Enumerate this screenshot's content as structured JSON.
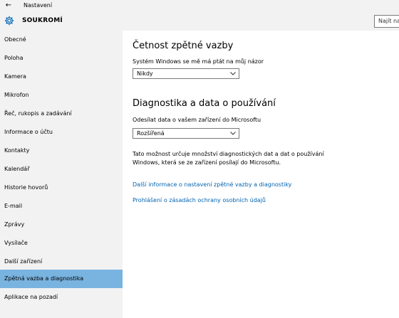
{
  "window": {
    "back_glyph": "←",
    "title": "Nastavení"
  },
  "header": {
    "section": "SOUKROMÍ",
    "search_placeholder": "Najít nas"
  },
  "sidebar": {
    "items": [
      {
        "label": "Obecné"
      },
      {
        "label": "Poloha"
      },
      {
        "label": "Kamera"
      },
      {
        "label": "Mikrofon"
      },
      {
        "label": "Řeč, rukopis a zadávání"
      },
      {
        "label": "Informace o účtu"
      },
      {
        "label": "Kontakty"
      },
      {
        "label": "Kalendář"
      },
      {
        "label": "Historie hovorů"
      },
      {
        "label": "E-mail"
      },
      {
        "label": "Zprávy"
      },
      {
        "label": "Vysílače"
      },
      {
        "label": "Další zařízení"
      },
      {
        "label": "Zpětná vazba a diagnostika"
      },
      {
        "label": "Aplikace na pozadí"
      }
    ],
    "selected_index": 13
  },
  "main": {
    "feedback": {
      "heading": "Četnost zpětné vazby",
      "label": "Systém Windows se mě má ptát na můj názor",
      "value": "Nikdy"
    },
    "diagnostics": {
      "heading": "Diagnostika a data o používání",
      "label": "Odesílat data o vašem zařízení do Microsoftu",
      "value": "Rozšířená",
      "description": "Tato možnost určuje množství diagnostických dat a dat o používání Windows, která se ze zařízení posílají do Microsoftu."
    },
    "links": {
      "more_info": "Další informace o nastavení zpětné vazby a diagnostiky",
      "privacy": "Prohlášení o zásadách ochrany osobních údajů"
    }
  },
  "colors": {
    "accent": "#0063b1",
    "selected": "#79b3e0",
    "chrome": "#f2f2f2"
  },
  "icons": {
    "back": "arrow-left-icon",
    "section": "gear-icon",
    "dropdown": "chevron-down-icon"
  }
}
